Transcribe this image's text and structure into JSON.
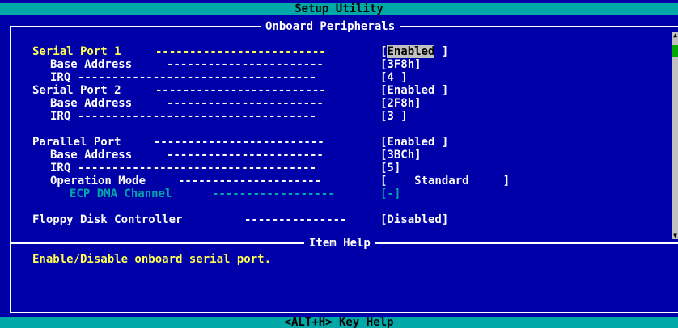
{
  "title": "Setup Utility",
  "page_caption": "Onboard Peripherals",
  "settings": [
    {
      "label": "Serial Port 1",
      "value": "Enabled",
      "state": "selected"
    },
    {
      "label": "Base Address",
      "value": "[3F8h]",
      "state": "normal"
    },
    {
      "label": "IRQ",
      "value": "[4 ]",
      "state": "normal"
    },
    {
      "label": "Serial Port 2",
      "value": "[Enabled ]",
      "state": "normal"
    },
    {
      "label": "Base Address",
      "value": "[2F8h]",
      "state": "normal"
    },
    {
      "label": "IRQ",
      "value": "[3 ]",
      "state": "normal"
    },
    {
      "label": "Parallel Port",
      "value": "[Enabled ]",
      "state": "normal"
    },
    {
      "label": "Base Address",
      "value": "[3BCh]",
      "state": "normal"
    },
    {
      "label": "IRQ",
      "value": "[5]",
      "state": "normal"
    },
    {
      "label": "Operation Mode",
      "value": "[    Standard     ]",
      "state": "normal"
    },
    {
      "label": "ECP DMA Channel",
      "value": "[-]",
      "state": "disabled"
    },
    {
      "label": "Floppy Disk Controller",
      "value": "[Disabled]",
      "state": "normal"
    }
  ],
  "help": {
    "caption": "Item Help",
    "text": "Enable/Disable onboard serial port."
  },
  "footer": {
    "key_hint": "<ALT+H>  Key Help"
  },
  "colors": {
    "background": "#0000a8",
    "title_bar": "#00a8a8",
    "active_label": "#ffff54",
    "disabled": "#00a8a8",
    "highlight": "#c0c0c0",
    "scroll_thumb": "#00a800"
  },
  "icons": [
    "scroll-up-arrow-icon",
    "scroll-down-arrow-icon"
  ]
}
